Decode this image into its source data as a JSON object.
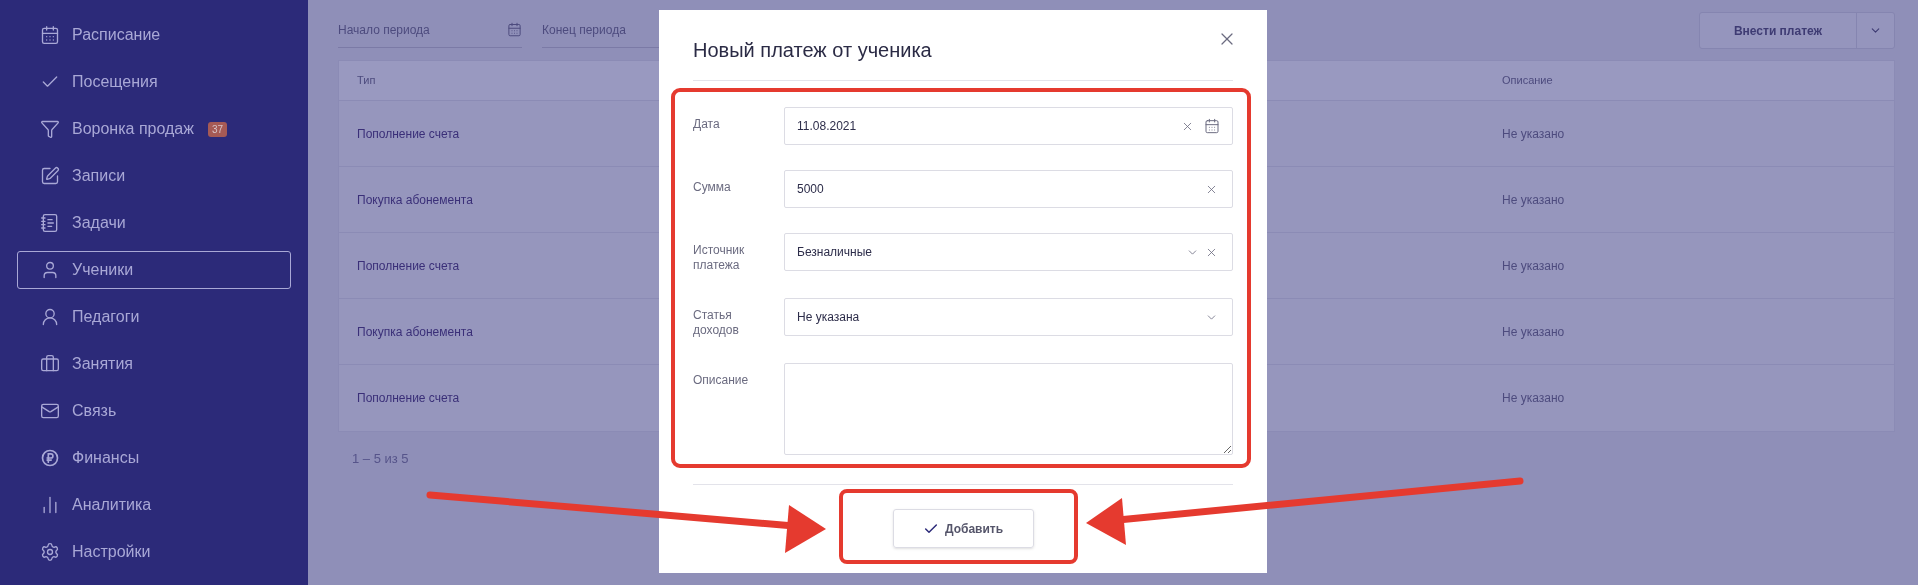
{
  "sidebar": {
    "items": [
      {
        "label": "Расписание",
        "selected": false
      },
      {
        "label": "Посещения",
        "selected": false
      },
      {
        "label": "Воронка продаж",
        "badge": "37",
        "selected": false
      },
      {
        "label": "Записи",
        "selected": false
      },
      {
        "label": "Задачи",
        "selected": false
      },
      {
        "label": "Ученики",
        "selected": true
      },
      {
        "label": "Педагоги",
        "selected": false
      },
      {
        "label": "Занятия",
        "selected": false
      },
      {
        "label": "Связь",
        "selected": false
      },
      {
        "label": "Финансы",
        "selected": false
      },
      {
        "label": "Аналитика",
        "selected": false
      },
      {
        "label": "Настройки",
        "selected": false
      }
    ]
  },
  "filters": [
    {
      "placeholder": "Начало периода",
      "calendar": true
    },
    {
      "placeholder": "Конец периода",
      "calendar": false
    }
  ],
  "primary_button": {
    "label": "Внести платеж"
  },
  "table": {
    "columns": [
      "Тип",
      "Описание"
    ],
    "rows": [
      {
        "type": "Пополнение счета",
        "description": "Не указано"
      },
      {
        "type": "Покупка абонемента",
        "description": "Не указано"
      },
      {
        "type": "Пополнение счета",
        "description": "Не указано"
      },
      {
        "type": "Покупка абонемента",
        "description": "Не указано"
      },
      {
        "type": "Пополнение счета",
        "description": "Не указано"
      }
    ]
  },
  "pagination": "1 – 5 из 5",
  "modal": {
    "title": "Новый платеж от ученика",
    "fields": [
      {
        "label": "Дата",
        "kind": "date",
        "value": "11.08.2021",
        "clearable": true
      },
      {
        "label": "Сумма",
        "kind": "text",
        "value": "5000",
        "clearable": true
      },
      {
        "label": "Источник платежа",
        "kind": "select",
        "value": "Безналичные",
        "clearable": true
      },
      {
        "label": "Статья доходов",
        "kind": "select",
        "value": "Не указана",
        "clearable": false
      },
      {
        "label": "Описание",
        "kind": "textarea"
      }
    ],
    "submit_button": "Добавить"
  }
}
